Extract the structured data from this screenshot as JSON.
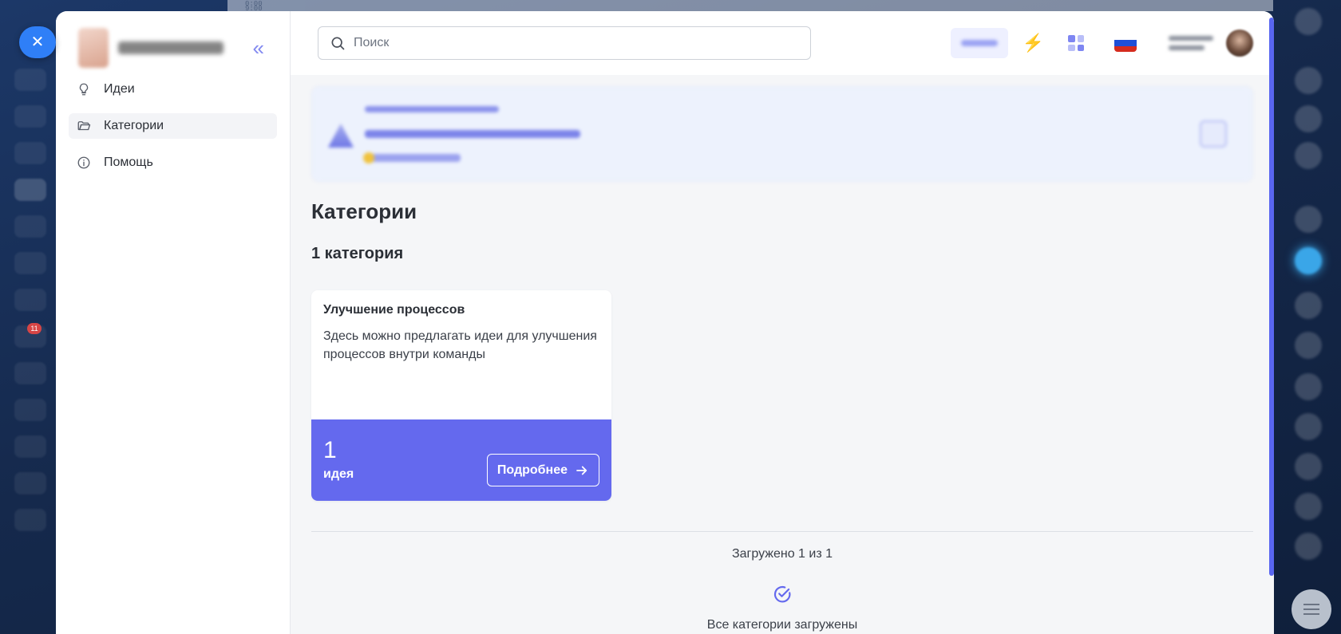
{
  "background": {
    "top_strip": [
      "0:00",
      "9:00"
    ],
    "notification_count": "11"
  },
  "modal": {
    "close_label": "✕"
  },
  "nav": {
    "collapse_label": "«",
    "items": [
      {
        "label": "Идеи",
        "icon": "lightbulb-icon",
        "active": false
      },
      {
        "label": "Категории",
        "icon": "folder-icon",
        "active": true
      },
      {
        "label": "Помощь",
        "icon": "info-icon",
        "active": false
      }
    ]
  },
  "search": {
    "placeholder": "Поиск",
    "value": ""
  },
  "topbar": {
    "bolt": "⚡",
    "flag_colors": [
      "#ffffff",
      "#1e4fd8",
      "#d52b1e"
    ]
  },
  "page": {
    "title": "Категории",
    "count_title": "1 категория"
  },
  "categories": [
    {
      "title": "Улучшение процессов",
      "description": "Здесь можно предлагать идеи для улучшения процессов внутри команды",
      "idea_count": "1",
      "idea_label": "идея",
      "button_label": "Подробнее"
    }
  ],
  "footer": {
    "loaded_text": "Загружено 1 из 1",
    "all_loaded_text": "Все категории загружены"
  },
  "colors": {
    "accent": "#6469ee",
    "close_button": "#2f7ff7",
    "bolt": "#f28b1e"
  }
}
